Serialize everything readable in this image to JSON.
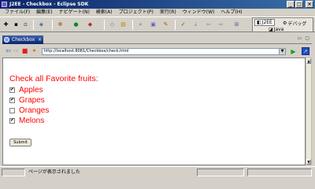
{
  "window": {
    "title": "J2EE - Checkbox - Eclipse SDK",
    "buttons": [
      "_",
      "□",
      "×"
    ]
  },
  "menubar": {
    "items": [
      "ファイル(F)",
      "編集(E)",
      "ナビゲート(N)",
      "検索(A)",
      "プロジェクト(P)",
      "実行(R)",
      "ウィンドウ(W)",
      "ヘルプ(H)"
    ]
  },
  "perspectives": {
    "items": [
      "J2EE",
      "デバッグ",
      "Java"
    ]
  },
  "editor": {
    "tab_label": "Checkbox",
    "tab_close": "×"
  },
  "browser": {
    "url": "http://localhost:8081/Checkbox/check.html",
    "dropdown_arrow": "▼"
  },
  "page": {
    "heading": "Check all Favorite fruits:",
    "fruits": [
      {
        "label": "Apples",
        "checked": true
      },
      {
        "label": "Grapes",
        "checked": true
      },
      {
        "label": "Oranges",
        "checked": false
      },
      {
        "label": "Melons",
        "checked": true
      }
    ],
    "submit_label": "Submit"
  },
  "status": {
    "text": "ページが表示されました"
  },
  "colors": {
    "accent_red": "#ff0000",
    "title_blue": "#0a246a"
  }
}
